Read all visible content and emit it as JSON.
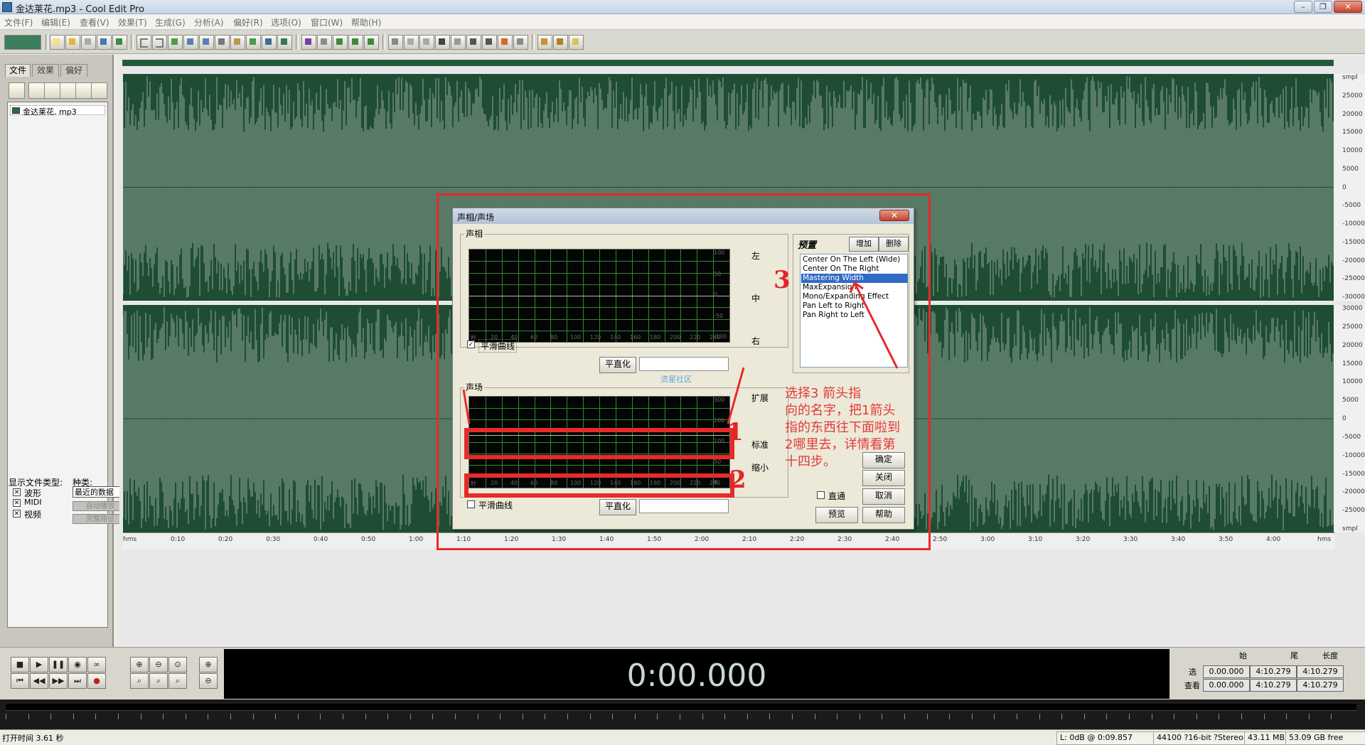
{
  "window": {
    "title": "金达莱花.mp3 - Cool Edit Pro",
    "min": "–",
    "max": "❐",
    "close": "✕"
  },
  "menu": [
    "文件(F)",
    "编辑(E)",
    "查看(V)",
    "效果(T)",
    "生成(G)",
    "分析(A)",
    "偏好(R)",
    "选项(O)",
    "窗口(W)",
    "帮助(H)"
  ],
  "left_panel": {
    "tabs": [
      "文件",
      "效果",
      "偏好"
    ],
    "file_item": "金达莱花. mp3",
    "show_type_label": "显示文件类型:",
    "kind_label": "种类:",
    "type_options": [
      "波形",
      "MIDI",
      "视频"
    ],
    "kind_value": "最近的数据",
    "autoplay_btn": "自动播放",
    "full_path_btn": "完整路径"
  },
  "wave": {
    "y_labels_top": [
      "smpl",
      "25000",
      "20000",
      "15000",
      "10000",
      "5000",
      "0",
      "-5000",
      "-10000",
      "-15000",
      "-20000",
      "-25000",
      "-30000"
    ],
    "y_labels_bot": [
      "30000",
      "25000",
      "20000",
      "15000",
      "10000",
      "5000",
      "0",
      "-5000",
      "-10000",
      "-15000",
      "-20000",
      "-25000",
      "smpl"
    ],
    "x_labels": [
      "hms",
      "0:10",
      "0:20",
      "0:30",
      "0:40",
      "0:50",
      "1:00",
      "1:10",
      "1:20",
      "1:30",
      "1:40",
      "1:50",
      "2:00",
      "2:10",
      "2:20",
      "2:30",
      "2:40",
      "2:50",
      "3:00",
      "3:10",
      "3:20",
      "3:30",
      "3:40",
      "3:50",
      "4:00",
      "hms"
    ],
    "color": "#1e4d33"
  },
  "dialog": {
    "title": "声相/声场",
    "close": "✕",
    "pan_group": "声相",
    "pan_right_labels": [
      "左",
      "中",
      "右"
    ],
    "pan_y_labels": [
      "100",
      "50",
      "0",
      "-50",
      "-100"
    ],
    "x_axis": [
      "秒",
      "20",
      "40",
      "60",
      "80",
      "100",
      "120",
      "140",
      "160",
      "180",
      "200",
      "220",
      "240"
    ],
    "smooth_curve": "平滑曲线",
    "flatten": "平直化",
    "stereo_group": "声场",
    "stereo_right_labels": [
      "扩展",
      "标准",
      "缩小"
    ],
    "stereo_y_labels": [
      "300",
      "200",
      "100",
      "50",
      "0"
    ],
    "watermark": "流星社区",
    "preset_title": "预置",
    "add": "增加",
    "delete": "删除",
    "presets": [
      "Center On The Left (Wide)",
      "Center On The Right",
      "Mastering Width",
      "MaxExpansion",
      "Mono/Expanding Effect",
      "Pan Left to Right",
      "Pan Right to Left"
    ],
    "selected_preset": 2,
    "ok": "确定",
    "close_btn": "关闭",
    "bypass": "直通",
    "cancel": "取消",
    "preview": "预览",
    "help": "帮助"
  },
  "annotation": {
    "text": [
      "选择3 箭头指",
      "向的名字，把1箭头",
      "指的东西往下面啦到",
      "2哪里去，详情看第",
      "十四步。"
    ],
    "num1": "1",
    "num2": "2",
    "num3": "3",
    "color": "#e72a2a"
  },
  "transport": {
    "time": "0:00.000",
    "col_headers": [
      "始",
      "尾",
      "长度"
    ],
    "row_sel": "选",
    "row_view": "查看",
    "sel_values": [
      "0.00.000",
      "4:10.279",
      "4:10.279"
    ],
    "view_values": [
      "0.00.000",
      "4:10.279",
      "4:10.279"
    ]
  },
  "status": {
    "open_time": "打开时间  3.61 秒",
    "level": "L: 0dB @  0:09.857",
    "format": "44100 ?16-bit ?Stereo",
    "size": "43.11 MB",
    "free": "53.09 GB free"
  }
}
